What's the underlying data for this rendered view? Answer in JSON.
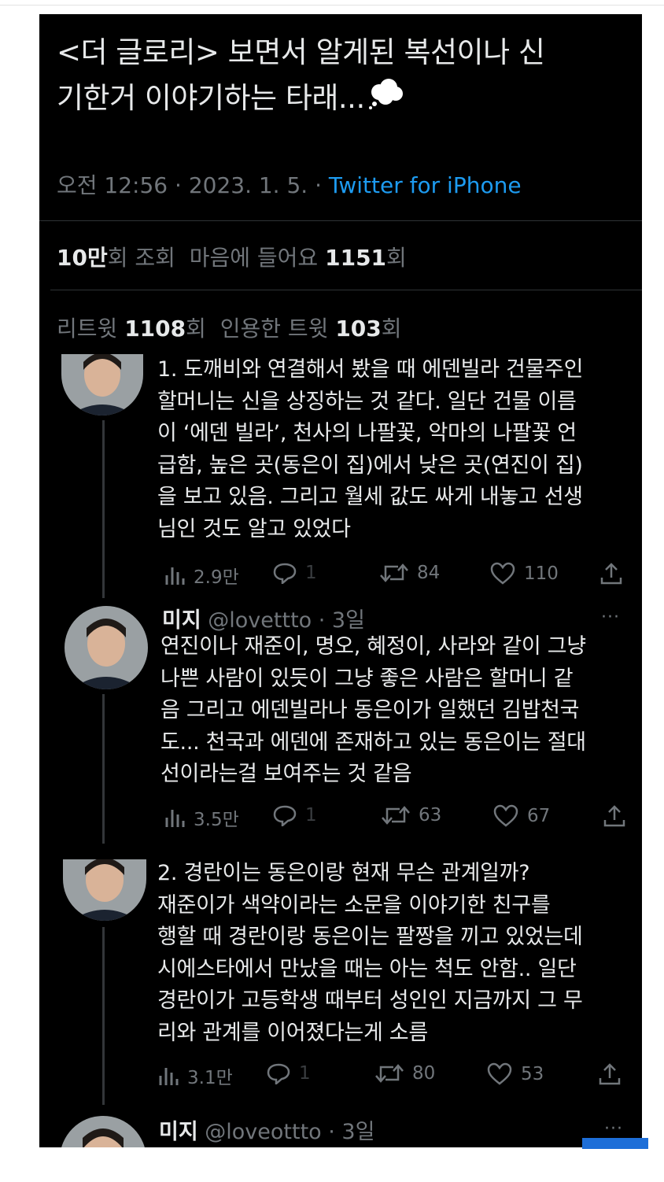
{
  "tweet": {
    "title_line1": "<더 글로리> 보면서 알게된 복선이나 신",
    "title_line2": "기한거 이야기하는 타래...",
    "emoji_icon": "thought-balloon",
    "time": "오전 12:56 · 2023. 1. 5. · ",
    "source": "Twitter for iPhone",
    "views_value": "10만",
    "views_suffix": "회 조회",
    "likes_prefix": "마음에 들어요",
    "likes_value": "1151",
    "likes_suffix": "회",
    "retweets_prefix": "리트윗",
    "retweets_value": "1108",
    "retweets_suffix": "회",
    "quotes_prefix": "인용한 트윗",
    "quotes_value": "103",
    "quotes_suffix": "회"
  },
  "replies": [
    {
      "lines": [
        "1. 도깨비와 연결해서 봤을 때 에덴빌라 건물주인",
        "할머니는 신을 상징하는 것 같다. 일단 건물 이름",
        "이 ‘에덴 빌라’, 천사의 나팔꽃, 악마의 나팔꽃 언",
        "급함, 높은 곳(동은이 집)에서 낮은 곳(연진이 집)",
        "을 보고 있음. 그리고 월세 값도 싸게 내놓고 선생",
        "님인 것도 알고 있었다"
      ],
      "views": "2.9만",
      "replies": "1",
      "retweets": "84",
      "likes": "110"
    },
    {
      "name": "미지",
      "handle": "@lovettto · 3일",
      "more": "···",
      "lines": [
        "연진이나 재준이, 명오, 혜정이, 사라와 같이 그냥",
        "나쁜 사람이 있듯이 그냥 좋은 사람은 할머니 같",
        "음 그리고 에덴빌라나 동은이가 일했던 김밥천국",
        "도... 천국과 에덴에 존재하고 있는 동은이는 절대",
        "선이라는걸 보여주는 것 같음"
      ],
      "views": "3.5만",
      "replies": "1",
      "retweets": "63",
      "likes": "67"
    },
    {
      "lines": [
        "2. 경란이는 동은이랑 현재 무슨 관계일까?",
        "재준이가 색약이라는 소문을 이야기한 친구를",
        "행할 때 경란이랑 동은이는 팔짱을 끼고 있었는데",
        "시에스타에서 만났을 때는 아는 척도 안함.. 일단",
        "경란이가 고등학생 때부터 성인인 지금까지 그 무",
        "리와 관계를 이어졌다는게 소름"
      ],
      "views": "3.1만",
      "replies": "1",
      "retweets": "80",
      "likes": "53"
    },
    {
      "name": "미지",
      "handle": "@loveottto · 3일",
      "more": "···"
    }
  ],
  "colors": {
    "background": "#000000",
    "text": "#e7e9ea",
    "muted": "#71767b",
    "link": "#1d9bf0",
    "divider": "#2f3336"
  }
}
